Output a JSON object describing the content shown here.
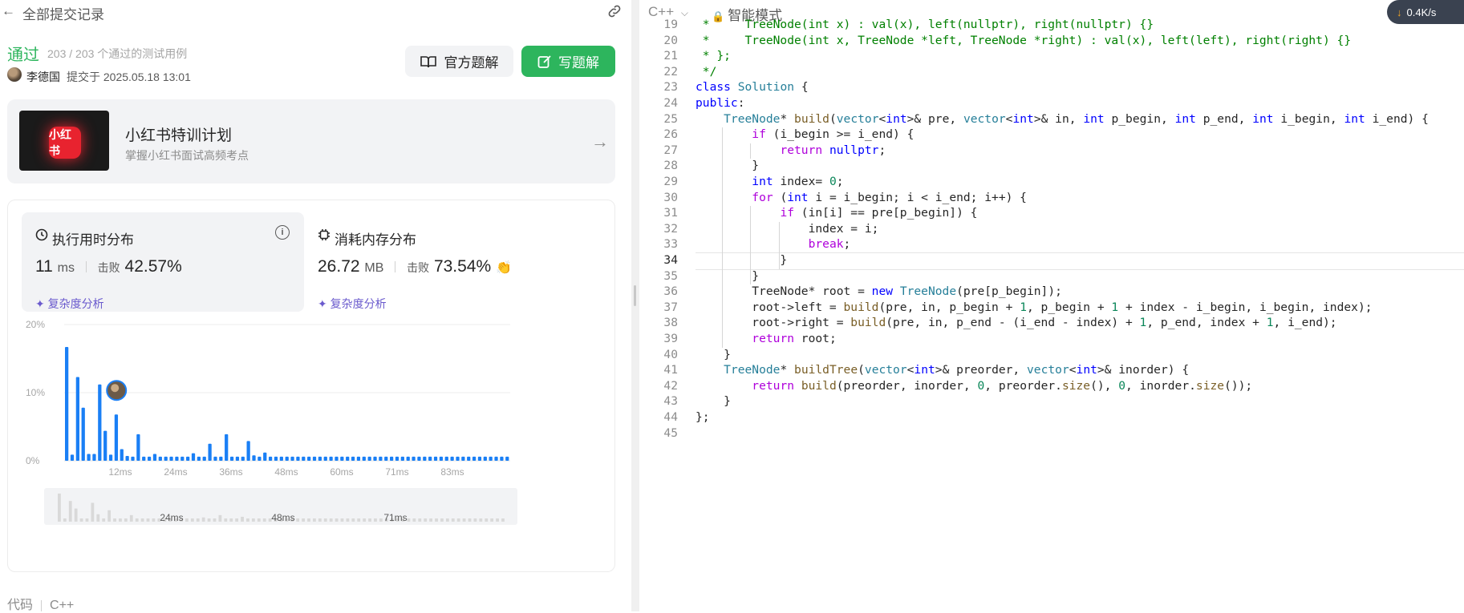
{
  "header": {
    "back_title": "全部提交记录"
  },
  "submission": {
    "status": "通过",
    "cases": "203 / 203 个通过的测试用例",
    "author": "李德国",
    "submitted_at": "提交于 2025.05.18 13:01",
    "btn_official": "官方题解",
    "btn_write": "写题解"
  },
  "promo": {
    "title": "小红书特训计划",
    "subtitle": "掌握小红书面试高频考点",
    "logo_text": "小红书"
  },
  "stats": {
    "runtime_title": "执行用时分布",
    "runtime_value": "11",
    "runtime_unit": "ms",
    "beat_label": "击败",
    "runtime_beat": "42.57%",
    "memory_title": "消耗内存分布",
    "memory_value": "26.72",
    "memory_unit": "MB",
    "memory_beat": "73.54%",
    "complexity": "复杂度分析"
  },
  "chart_data": {
    "type": "bar",
    "title": "",
    "ylabel": "",
    "xlabel": "",
    "y_ticks": [
      "20%",
      "10%",
      "0%"
    ],
    "ylim": [
      0,
      20
    ],
    "x_ticks": [
      "12ms",
      "24ms",
      "36ms",
      "48ms",
      "60ms",
      "71ms",
      "83ms"
    ],
    "values": [
      16.7,
      0.9,
      12.3,
      7.8,
      1.0,
      1.0,
      11.2,
      4.4,
      0.9,
      6.8,
      1.7,
      0.7,
      0.6,
      3.9,
      0.6,
      0.6,
      1.0,
      0.6,
      0.6,
      0.6,
      0.6,
      0.6,
      0.6,
      1.1,
      0.6,
      0.6,
      2.5,
      0.6,
      0.6,
      3.9,
      0.6,
      0.6,
      0.6,
      2.9,
      0.8,
      0.6,
      1.2,
      0.6,
      0.6,
      0.6,
      0.6,
      0.6,
      0.6,
      0.6,
      0.6,
      0.6,
      0.6,
      0.6,
      0.6,
      0.6,
      0.6,
      0.6,
      0.6,
      0.6,
      0.6,
      0.6,
      0.6,
      0.6,
      0.6,
      0.6,
      0.6,
      0.6,
      0.6,
      0.6,
      0.6,
      0.6,
      0.6,
      0.6,
      0.6,
      0.6,
      0.6,
      0.6,
      0.6,
      0.6,
      0.6,
      0.6,
      0.6,
      0.6,
      0.6,
      0.6,
      0.6
    ],
    "highlight_index": 9,
    "color": "#1a7ff5",
    "navigator_ticks": [
      "24ms",
      "48ms",
      "71ms"
    ]
  },
  "footer": {
    "code_label": "代码",
    "lang": "C++"
  },
  "editor": {
    "language": "C++",
    "mode": "智能模式",
    "net_speed": "0.4K/s",
    "start_line": 19,
    "active_line": 34,
    "lines": [
      [
        [
          "cm",
          " *     TreeNode(int x) : val(x), left(nullptr), right(nullptr) {}"
        ]
      ],
      [
        [
          "cm",
          " *     TreeNode(int x, TreeNode *left, TreeNode *right) : val(x), left(left), right(right) {}"
        ]
      ],
      [
        [
          "cm",
          " * };"
        ]
      ],
      [
        [
          "cm",
          " */"
        ]
      ],
      [
        [
          "kw",
          "class"
        ],
        [
          "",
          " "
        ],
        [
          "ty",
          "Solution"
        ],
        [
          "",
          " {"
        ]
      ],
      [
        [
          "kw",
          "public"
        ],
        [
          "",
          ":"
        ]
      ],
      [
        [
          "",
          "    "
        ],
        [
          "ty",
          "TreeNode"
        ],
        [
          "",
          "* "
        ],
        [
          "fn",
          "build"
        ],
        [
          "",
          "("
        ],
        [
          "ty",
          "vector"
        ],
        [
          "",
          "<"
        ],
        [
          "kw",
          "int"
        ],
        [
          "",
          ">& pre, "
        ],
        [
          "ty",
          "vector"
        ],
        [
          "",
          "<"
        ],
        [
          "kw",
          "int"
        ],
        [
          "",
          ">& in, "
        ],
        [
          "kw",
          "int"
        ],
        [
          "",
          " p_begin, "
        ],
        [
          "kw",
          "int"
        ],
        [
          "",
          " p_end, "
        ],
        [
          "kw",
          "int"
        ],
        [
          "",
          " i_begin, "
        ],
        [
          "kw",
          "int"
        ],
        [
          "",
          " i_end) {"
        ]
      ],
      [
        [
          "",
          "        "
        ],
        [
          "kw2",
          "if"
        ],
        [
          "",
          " (i_begin >= i_end) {"
        ]
      ],
      [
        [
          "",
          "            "
        ],
        [
          "kw2",
          "return"
        ],
        [
          "",
          " "
        ],
        [
          "kw",
          "nullptr"
        ],
        [
          "",
          ";"
        ]
      ],
      [
        [
          "",
          "        }"
        ]
      ],
      [
        [
          "",
          "        "
        ],
        [
          "kw",
          "int"
        ],
        [
          "",
          " index= "
        ],
        [
          "num",
          "0"
        ],
        [
          "",
          ";"
        ]
      ],
      [
        [
          "",
          "        "
        ],
        [
          "kw2",
          "for"
        ],
        [
          "",
          " ("
        ],
        [
          "kw",
          "int"
        ],
        [
          "",
          " i = i_begin; i < i_end; i++) {"
        ]
      ],
      [
        [
          "",
          "            "
        ],
        [
          "kw2",
          "if"
        ],
        [
          "",
          " (in[i] == pre[p_begin]) {"
        ]
      ],
      [
        [
          "",
          "                index = i;"
        ]
      ],
      [
        [
          "",
          "                "
        ],
        [
          "kw2",
          "break"
        ],
        [
          "",
          ";"
        ]
      ],
      [
        [
          "",
          "            }"
        ]
      ],
      [
        [
          "",
          "        }"
        ]
      ],
      [
        [
          "",
          "        TreeNode* root = "
        ],
        [
          "kw",
          "new"
        ],
        [
          "",
          " "
        ],
        [
          "ty",
          "TreeNode"
        ],
        [
          "",
          "(pre[p_begin]);"
        ]
      ],
      [
        [
          "",
          "        root->left = "
        ],
        [
          "fn",
          "build"
        ],
        [
          "",
          "(pre, in, p_begin + "
        ],
        [
          "num",
          "1"
        ],
        [
          "",
          ", p_begin + "
        ],
        [
          "num",
          "1"
        ],
        [
          "",
          " + index - i_begin, i_begin, index);"
        ]
      ],
      [
        [
          "",
          "        root->right = "
        ],
        [
          "fn",
          "build"
        ],
        [
          "",
          "(pre, in, p_end - (i_end - index) + "
        ],
        [
          "num",
          "1"
        ],
        [
          "",
          ", p_end, index + "
        ],
        [
          "num",
          "1"
        ],
        [
          "",
          ", i_end);"
        ]
      ],
      [
        [
          "",
          "        "
        ],
        [
          "kw2",
          "return"
        ],
        [
          "",
          " root;"
        ]
      ],
      [
        [
          "",
          "    }"
        ]
      ],
      [
        [
          "",
          "    "
        ],
        [
          "ty",
          "TreeNode"
        ],
        [
          "",
          "* "
        ],
        [
          "fn",
          "buildTree"
        ],
        [
          "",
          "("
        ],
        [
          "ty",
          "vector"
        ],
        [
          "",
          "<"
        ],
        [
          "kw",
          "int"
        ],
        [
          "",
          ">& preorder, "
        ],
        [
          "ty",
          "vector"
        ],
        [
          "",
          "<"
        ],
        [
          "kw",
          "int"
        ],
        [
          "",
          ">& inorder) {"
        ]
      ],
      [
        [
          "",
          "        "
        ],
        [
          "kw2",
          "return"
        ],
        [
          "",
          " "
        ],
        [
          "fn",
          "build"
        ],
        [
          "",
          "(preorder, inorder, "
        ],
        [
          "num",
          "0"
        ],
        [
          "",
          ", preorder."
        ],
        [
          "fn",
          "size"
        ],
        [
          "",
          "(), "
        ],
        [
          "num",
          "0"
        ],
        [
          "",
          ", inorder."
        ],
        [
          "fn",
          "size"
        ],
        [
          "",
          "());"
        ]
      ],
      [
        [
          "",
          "    }"
        ]
      ],
      [
        [
          "",
          "};"
        ]
      ],
      [
        [
          "",
          ""
        ]
      ]
    ]
  }
}
